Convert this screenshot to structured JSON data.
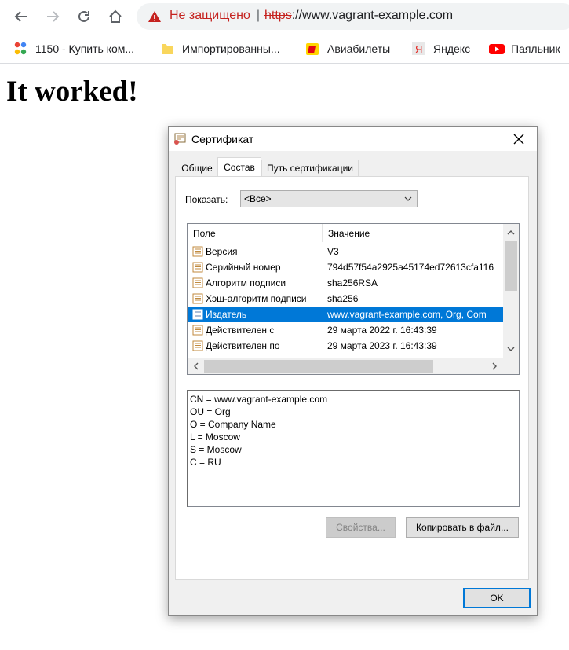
{
  "browser": {
    "omnibox": {
      "security_text": "Не защищено",
      "scheme": "https",
      "url_rest": "://www.vagrant-example.com"
    },
    "bookmarks": [
      {
        "label": "1150 - Купить ком..."
      },
      {
        "label": "Импортированны..."
      },
      {
        "label": "Авиабилеты"
      },
      {
        "label": "Яндекс"
      },
      {
        "label": "Паяльник"
      }
    ]
  },
  "page": {
    "heading": "It worked!"
  },
  "dialog": {
    "title": "Сертификат",
    "tabs": [
      "Общие",
      "Состав",
      "Путь сертификации"
    ],
    "active_tab": "Состав",
    "show_label": "Показать:",
    "show_value": "<Все>",
    "columns": [
      "Поле",
      "Значение"
    ],
    "rows": [
      {
        "field": "Версия",
        "value": "V3"
      },
      {
        "field": "Серийный номер",
        "value": "794d57f54a2925a45174ed72613cfa116"
      },
      {
        "field": "Алгоритм подписи",
        "value": "sha256RSA"
      },
      {
        "field": "Хэш-алгоритм подписи",
        "value": "sha256"
      },
      {
        "field": "Издатель",
        "value": "www.vagrant-example.com, Org, Com"
      },
      {
        "field": "Действителен с",
        "value": "29 марта 2022 г. 16:43:39"
      },
      {
        "field": "Действителен по",
        "value": "29 марта 2023 г. 16:43:39"
      }
    ],
    "selected_row": "Издатель",
    "detail_lines": [
      "CN = www.vagrant-example.com",
      "OU = Org",
      "O = Company Name",
      "L = Moscow",
      "S = Moscow",
      "C = RU"
    ],
    "buttons": {
      "properties": "Свойства...",
      "copy_to_file": "Копировать в файл...",
      "ok": "OK"
    }
  },
  "colors": {
    "selection": "#0078d7",
    "insecure": "#c5221f"
  }
}
